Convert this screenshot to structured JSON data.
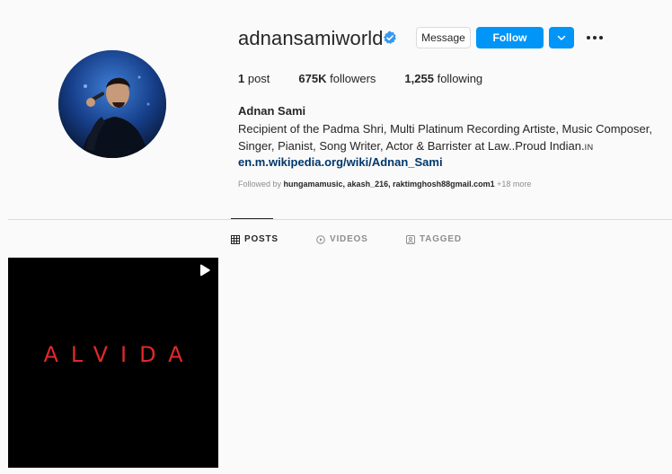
{
  "profile": {
    "username": "adnansamiworld",
    "verified": true,
    "message_label": "Message",
    "follow_label": "Follow",
    "avatar_alt": "Adnan Sami avatar"
  },
  "stats": {
    "posts_count": "1",
    "posts_label": " post",
    "followers_count": "675K",
    "followers_label": " followers",
    "following_count": "1,255",
    "following_label": " following"
  },
  "bio": {
    "full_name": "Adnan Sami",
    "line1": "Recipient of the Padma Shri, Multi Platinum Recording Artiste, Music Composer,",
    "line2": "Singer, Pianist, Song Writer, Actor & Barrister at Law..Proud Indian.",
    "line2_tag": "IN",
    "link": "en.m.wikipedia.org/wiki/Adnan_Sami",
    "followed_by_prefix": "Followed by ",
    "followed_by_names": "hungamamusic, akash_216, raktimghosh88gmail.com1",
    "followed_by_more": " +18 more"
  },
  "tabs": [
    {
      "label": "POSTS",
      "active": true
    },
    {
      "label": "VIDEOS",
      "active": false
    },
    {
      "label": "TAGGED",
      "active": false
    }
  ],
  "posts": [
    {
      "title": "ALVIDA",
      "type": "reel",
      "title_color": "#e2282b"
    }
  ],
  "colors": {
    "accent": "#0095f6",
    "link": "#00376b",
    "muted": "#8e8e8e",
    "background": "#fafafa"
  },
  "icons": [
    "verified-badge-icon",
    "chevron-down-icon",
    "more-options-icon",
    "grid-icon",
    "play-circle-icon",
    "tag-user-icon",
    "reel-play-icon"
  ]
}
